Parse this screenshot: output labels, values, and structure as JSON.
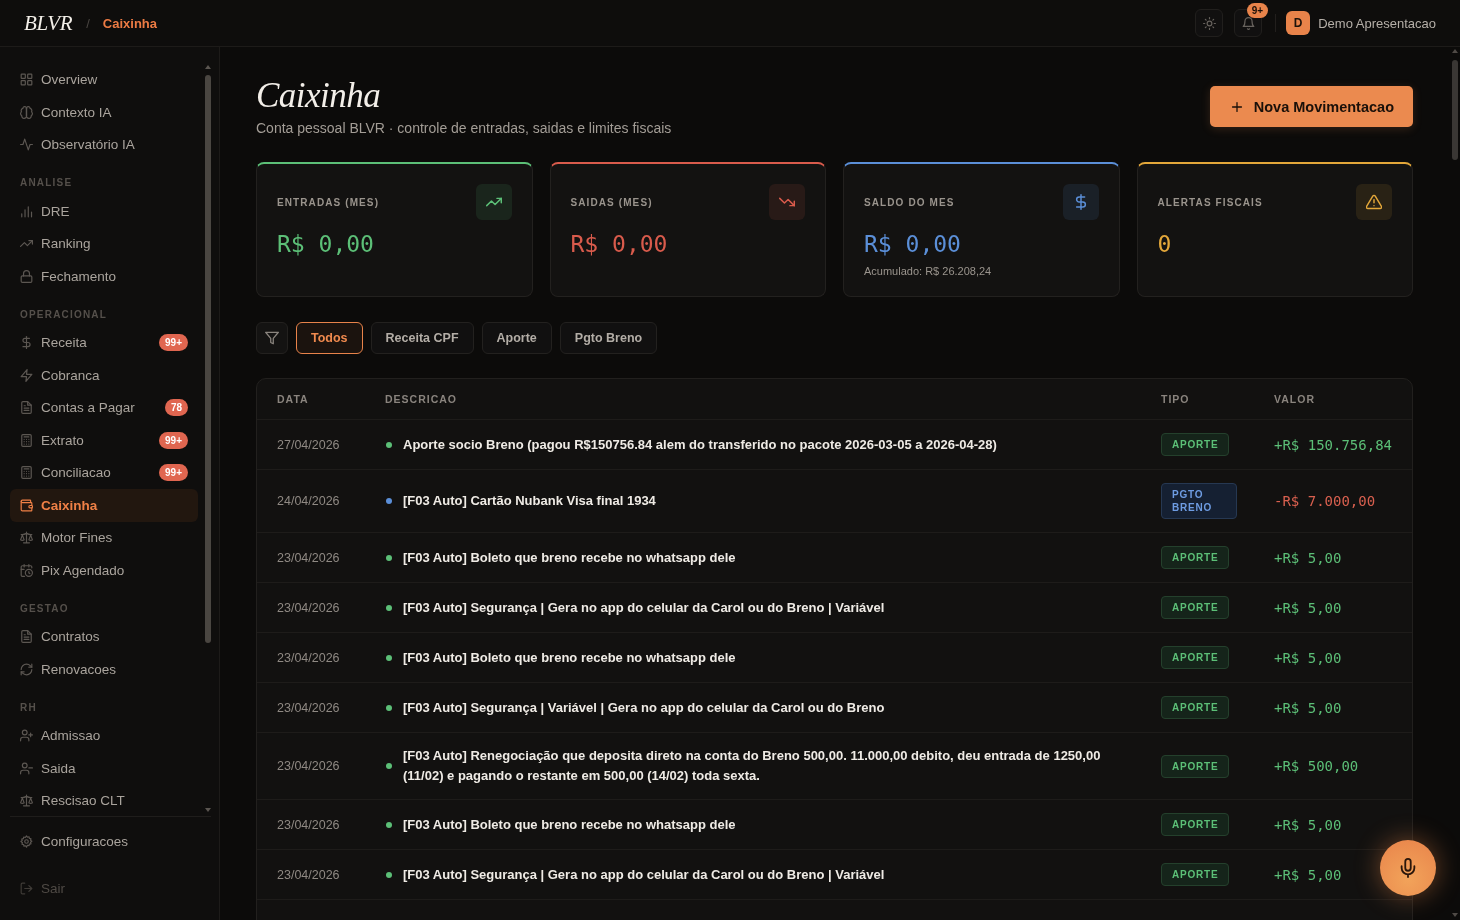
{
  "topbar": {
    "logo": "BLVR",
    "breadcrumb": {
      "separator": "/",
      "current": "Caixinha"
    },
    "notifications": {
      "count": "9+"
    },
    "user": {
      "initial": "D",
      "name": "Demo Apresentacao"
    }
  },
  "sidebar": {
    "sections": [
      {
        "items": [
          {
            "label": "Overview",
            "selected": false
          },
          {
            "label": "Contexto IA",
            "selected": false
          },
          {
            "label": "Observatório IA",
            "selected": false
          }
        ]
      },
      {
        "title": "ANALISE",
        "items": [
          {
            "label": "DRE",
            "selected": false
          },
          {
            "label": "Ranking",
            "selected": false
          },
          {
            "label": "Fechamento",
            "selected": false
          }
        ]
      },
      {
        "title": "OPERACIONAL",
        "items": [
          {
            "label": "Receita",
            "selected": false,
            "badge": "99+"
          },
          {
            "label": "Cobranca",
            "selected": false
          },
          {
            "label": "Contas a Pagar",
            "selected": false,
            "badge": "78"
          },
          {
            "label": "Extrato",
            "selected": false,
            "badge": "99+"
          },
          {
            "label": "Conciliacao",
            "selected": false,
            "badge": "99+"
          },
          {
            "label": "Caixinha",
            "selected": true
          },
          {
            "label": "Motor Fines",
            "selected": false
          },
          {
            "label": "Pix Agendado",
            "selected": false
          }
        ]
      },
      {
        "title": "GESTAO",
        "items": [
          {
            "label": "Contratos",
            "selected": false
          },
          {
            "label": "Renovacoes",
            "selected": false
          }
        ]
      },
      {
        "title": "RH",
        "items": [
          {
            "label": "Admissao",
            "selected": false
          },
          {
            "label": "Saida",
            "selected": false
          },
          {
            "label": "Rescisao CLT",
            "selected": false
          }
        ]
      }
    ],
    "settings": {
      "label": "Configuracoes"
    },
    "logout": {
      "label": "Sair"
    }
  },
  "page": {
    "title": "Caixinha",
    "subtitle": "Conta pessoal BLVR · controle de entradas, saidas e limites fiscais",
    "action": {
      "label": "Nova Movimentacao"
    }
  },
  "stats": [
    {
      "label": "ENTRADAS (MES)",
      "value": "R$ 0,00",
      "color": "#5cbf77"
    },
    {
      "label": "SAIDAS (MES)",
      "value": "R$ 0,00",
      "color": "#d95b4c"
    },
    {
      "label": "SALDO DO MES",
      "value": "R$ 0,00",
      "note": "Acumulado: R$ 26.208,24",
      "color": "#5b8fd8"
    },
    {
      "label": "ALERTAS FISCAIS",
      "value": "0",
      "color": "#e3a73a"
    }
  ],
  "filters": [
    {
      "label": "Todos",
      "selected": true
    },
    {
      "label": "Receita CPF",
      "selected": false
    },
    {
      "label": "Aporte",
      "selected": false
    },
    {
      "label": "Pgto Breno",
      "selected": false
    }
  ],
  "table": {
    "columns": [
      "DATA",
      "DESCRICAO",
      "TIPO",
      "VALOR"
    ],
    "rows": [
      {
        "date": "27/04/2026",
        "description": "Aporte socio Breno (pagou R$150756.84 alem do transferido no pacote 2026-03-05 a 2026-04-28)",
        "color": "#5cbf77",
        "type": "APORTE",
        "kind": "aporte",
        "value": "+R$ 150.756,84"
      },
      {
        "date": "24/04/2026",
        "description": "[F03 Auto] Cartão Nubank Visa final 1934",
        "color": "#5b8fd8",
        "type": "PGTO BRENO",
        "kind": "pgto",
        "value": "-R$ 7.000,00"
      },
      {
        "date": "23/04/2026",
        "description": "[F03 Auto] Boleto que breno recebe no whatsapp dele",
        "color": "#5cbf77",
        "type": "APORTE",
        "kind": "aporte",
        "value": "+R$ 5,00"
      },
      {
        "date": "23/04/2026",
        "description": "[F03 Auto] Segurança | Gera no app do celular da Carol ou do Breno | Variável",
        "color": "#5cbf77",
        "type": "APORTE",
        "kind": "aporte",
        "value": "+R$ 5,00"
      },
      {
        "date": "23/04/2026",
        "description": "[F03 Auto] Boleto que breno recebe no whatsapp dele",
        "color": "#5cbf77",
        "type": "APORTE",
        "kind": "aporte",
        "value": "+R$ 5,00"
      },
      {
        "date": "23/04/2026",
        "description": "[F03 Auto] Segurança | Variável | Gera no app do celular da Carol ou do Breno",
        "color": "#5cbf77",
        "type": "APORTE",
        "kind": "aporte",
        "value": "+R$ 5,00"
      },
      {
        "date": "23/04/2026",
        "description": "[F03 Auto] Renegociação que deposita direto na conta do Breno 500,00. 11.000,00 debito, deu entrada de 1250,00 (11/02) e pagando o restante em 500,00 (14/02) toda sexta.",
        "color": "#5cbf77",
        "type": "APORTE",
        "kind": "aporte",
        "value": "+R$ 500,00"
      },
      {
        "date": "23/04/2026",
        "description": "[F03 Auto] Boleto que breno recebe no whatsapp dele",
        "color": "#5cbf77",
        "type": "APORTE",
        "kind": "aporte",
        "value": "+R$ 5,00"
      },
      {
        "date": "23/04/2026",
        "description": "[F03 Auto] Segurança | Gera no app do celular da Carol ou do Breno | Variável",
        "color": "#5cbf77",
        "type": "APORTE",
        "kind": "aporte",
        "value": "+R$ 5,00"
      }
    ]
  }
}
